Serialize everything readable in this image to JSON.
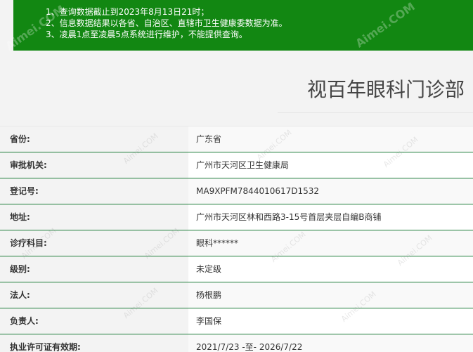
{
  "notice": {
    "lines": [
      "1、查询数据截止到2023年8月13日21时；",
      "2、信息数据结果以各省、自治区、直辖市卫生健康委数据为准。",
      "3、凌晨1点至凌晨5点系统进行维护，不能提供查询。"
    ],
    "watermark": "Aimei.COM"
  },
  "page_title": "视百年眼科门诊部",
  "details": [
    {
      "label": "省份:",
      "value": "广东省"
    },
    {
      "label": "审批机关:",
      "value": "广州市天河区卫生健康局"
    },
    {
      "label": "登记号:",
      "value": "MA9XPFM7844010617D1532"
    },
    {
      "label": "地址:",
      "value": "广州市天河区林和西路3-15号首层夹层自编B商铺"
    },
    {
      "label": "诊疗科目:",
      "value": "眼科******"
    },
    {
      "label": "级别:",
      "value": "未定级"
    },
    {
      "label": "法人:",
      "value": "杨根鹏"
    },
    {
      "label": "负责人:",
      "value": "李国保"
    },
    {
      "label": "执业许可证有效期:",
      "value": "2021/7/23 -至- 2026/7/22"
    }
  ],
  "colors": {
    "notice_bg": "#128712",
    "row_divider": "#1e7d3a",
    "text": "#333333"
  }
}
